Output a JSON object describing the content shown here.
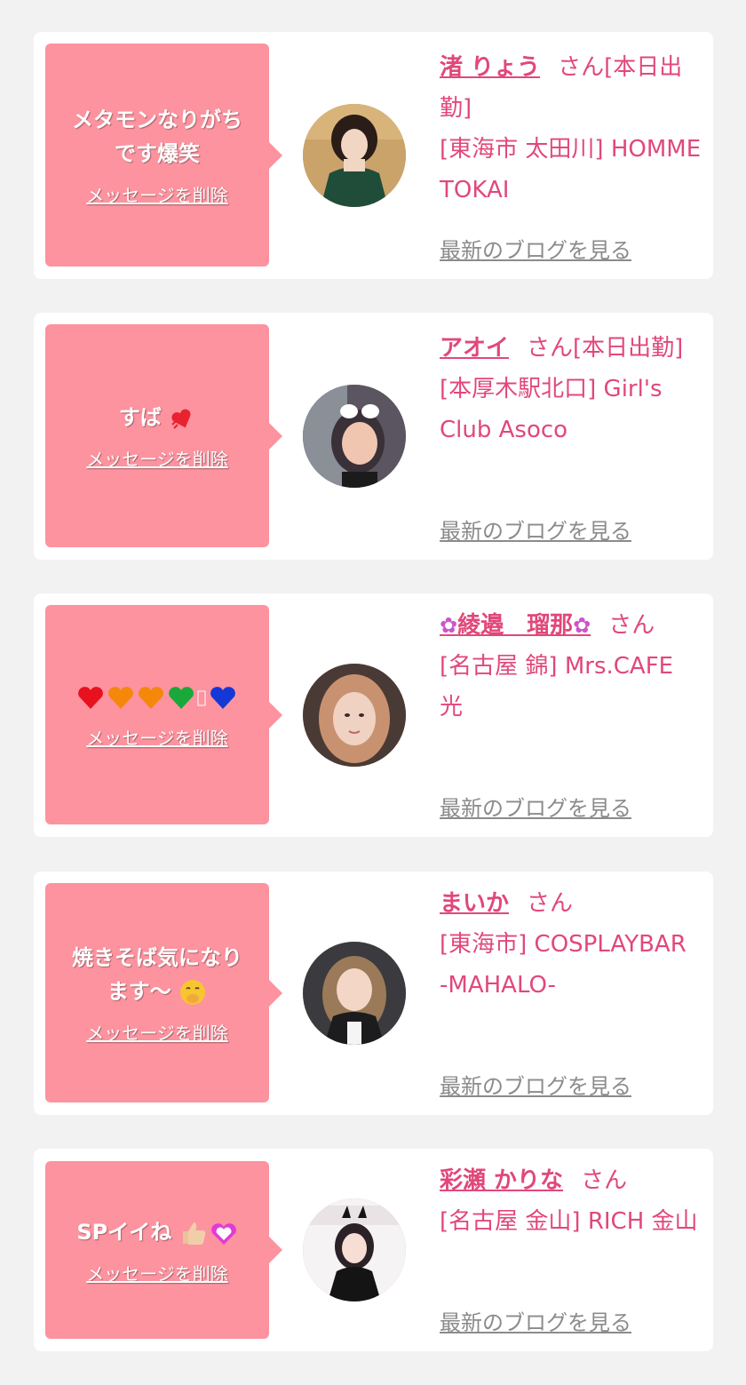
{
  "colors": {
    "page_background": "#f2f2f2",
    "card_background": "#ffffff",
    "bubble": "#fc939f",
    "accent_text": "#e1487a",
    "muted_link": "#8b8b8b"
  },
  "messages": [
    {
      "message_lines": [
        "メタモンなりがち",
        "です爆笑"
      ],
      "delete_label": "メッセージを削除",
      "name": "渚 りょう",
      "honorific": "さん[本日出勤]",
      "shop": "[東海市 太田川] HOMME TOKAI",
      "blog_label": "最新のブログを見る"
    },
    {
      "message_lines": [
        "すば"
      ],
      "message_emoji": "hearts",
      "delete_label": "メッセージを削除",
      "name": "アオイ",
      "honorific": "さん[本日出勤]",
      "shop": "[本厚木駅北口] Girl's Club Asoco",
      "blog_label": "最新のブログを見る"
    },
    {
      "message_lines": [
        ""
      ],
      "message_emoji": "rainbow-hearts",
      "delete_label": "メッセージを削除",
      "name_prefix_icon": "flower-icon",
      "name": "綾邉　瑠那",
      "name_suffix_icon": "flower-icon",
      "honorific": "さん",
      "shop": "[名古屋 錦] Mrs.CAFE 光",
      "blog_label": "最新のブログを見る"
    },
    {
      "message_lines": [
        "焼きそば気になり",
        "ます〜"
      ],
      "message_emoji": "giggle",
      "delete_label": "メッセージを削除",
      "name": "まいか",
      "honorific": "さん",
      "shop": "[東海市] COSPLAYBAR -MAHALO-",
      "blog_label": "最新のブログを見る"
    },
    {
      "message_lines": [
        "SPイイね"
      ],
      "message_emoji": "thumbs-heart",
      "delete_label": "メッセージを削除",
      "name": "彩瀬 かりな",
      "honorific": "さん",
      "shop": "[名古屋 金山] RICH 金山",
      "blog_label": "最新のブログを見る"
    }
  ]
}
